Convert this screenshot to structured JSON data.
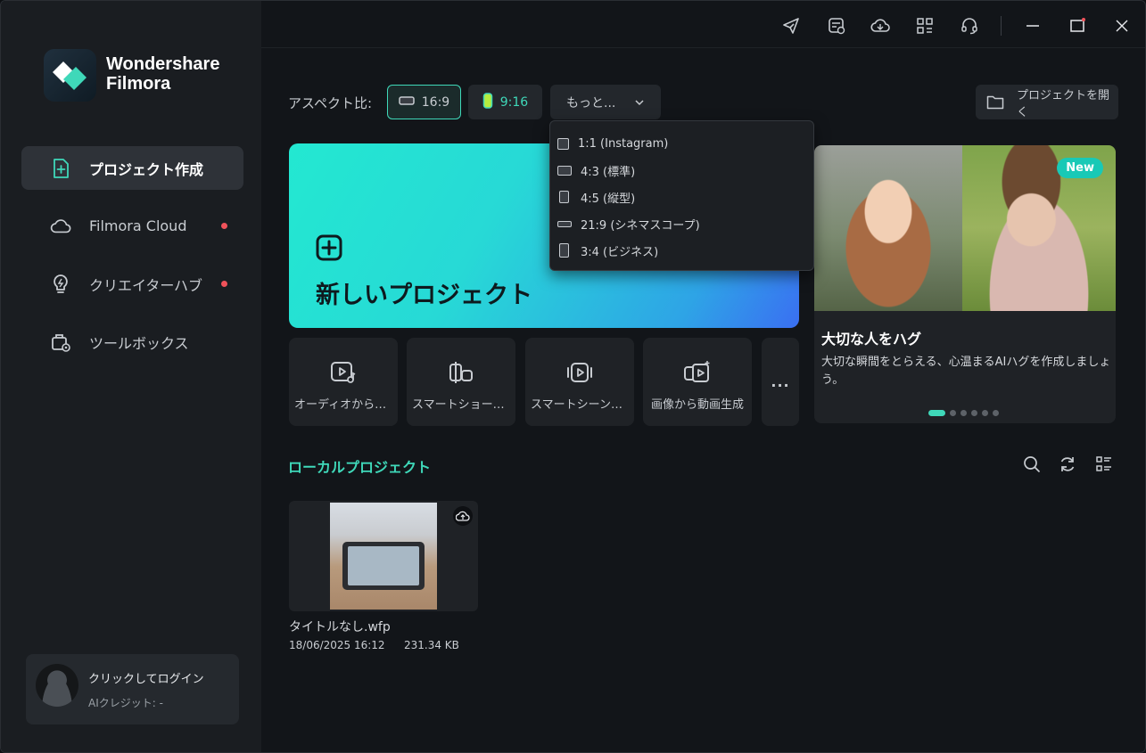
{
  "app": {
    "brand_line1": "Wondershare",
    "brand_line2": "Filmora"
  },
  "sidebar": {
    "items": [
      {
        "label": "プロジェクト作成",
        "icon": "new-project-icon",
        "active": true
      },
      {
        "label": "Filmora Cloud",
        "icon": "cloud-icon",
        "badge_dot": true
      },
      {
        "label": "クリエイターハブ",
        "icon": "lightbulb-icon",
        "badge_dot": true
      },
      {
        "label": "ツールボックス",
        "icon": "toolbox-icon"
      }
    ],
    "login": {
      "title": "クリックしてログイン",
      "credits": "AIクレジット: -"
    }
  },
  "titlebar": {
    "icons": [
      "send-icon",
      "task-list-icon",
      "cloud-sync-icon",
      "apps-grid-icon",
      "headset-icon"
    ],
    "window_controls": [
      "minimize-icon",
      "maximize-icon",
      "close-icon"
    ]
  },
  "aspect": {
    "label": "アスペクト比:",
    "options": [
      {
        "label": "16:9",
        "selected": true
      },
      {
        "label": "9:16"
      }
    ],
    "more_label": "もっと...",
    "dropdown": [
      {
        "label": "1:1 (Instagram)",
        "shape": "square"
      },
      {
        "label": "4:3 (標準)",
        "shape": "landscape"
      },
      {
        "label": "4:5 (縦型)",
        "shape": "portrait"
      },
      {
        "label": "21:9 (シネマスコープ)",
        "shape": "wide"
      },
      {
        "label": "3:4 (ビジネス)",
        "shape": "tall"
      }
    ]
  },
  "open_project_label": "プロジェクトを開く",
  "new_project": {
    "label": "新しいプロジェクト"
  },
  "tools": [
    {
      "label": "オーディオから動画",
      "icon": "audio-to-video-icon"
    },
    {
      "label": "スマートショートク...",
      "icon": "smart-short-clip-icon"
    },
    {
      "label": "スマートシーンカット",
      "icon": "smart-scene-cut-icon"
    },
    {
      "label": "画像から動画生成",
      "icon": "image-to-video-icon"
    }
  ],
  "more_tools_label": "...",
  "promo": {
    "badge": "New",
    "title": "大切な人をハグ",
    "description": "大切な瞬間をとらえる、心温まるAIハグを作成しましょう。",
    "slides": 6,
    "active_slide": 0
  },
  "local": {
    "title": "ローカルプロジェクト",
    "icons": [
      "search-icon",
      "refresh-icon",
      "list-view-icon"
    ],
    "projects": [
      {
        "name": "タイトルなし.wfp",
        "date": "18/06/2025 16:12",
        "size": "231.34 KB"
      }
    ]
  },
  "colors": {
    "accent": "#3fd8b9",
    "badge_dot": "#f0525a",
    "new_project_gradient_start": "#23e8d1",
    "new_project_gradient_end": "#3a6ff2"
  }
}
